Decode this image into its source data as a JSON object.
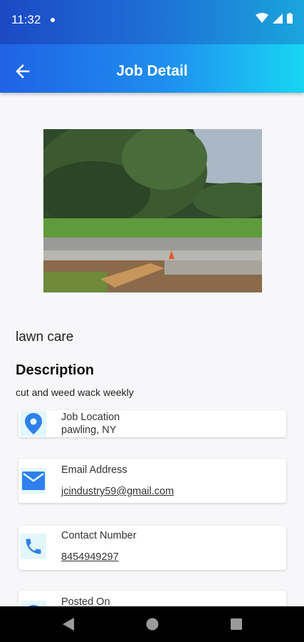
{
  "status_bar": {
    "time": "11:32"
  },
  "app_bar": {
    "title": "Job Detail"
  },
  "job": {
    "title": "lawn care",
    "description_heading": "Description",
    "description": "cut and weed wack weekly"
  },
  "details": {
    "location": {
      "label": "Job Location",
      "value": "pawling, NY",
      "icon": "location-pin-icon"
    },
    "email": {
      "label": "Email Address",
      "value": "jcindustry59@gmail.com",
      "icon": "mail-icon"
    },
    "phone": {
      "label": "Contact Number",
      "value": "8454949297",
      "icon": "phone-icon"
    },
    "posted": {
      "label": "Posted On",
      "icon": "clock-icon"
    }
  },
  "colors": {
    "accent": "#2f80ed",
    "appbar_start": "#1f62e4",
    "appbar_end": "#18d6f2"
  }
}
